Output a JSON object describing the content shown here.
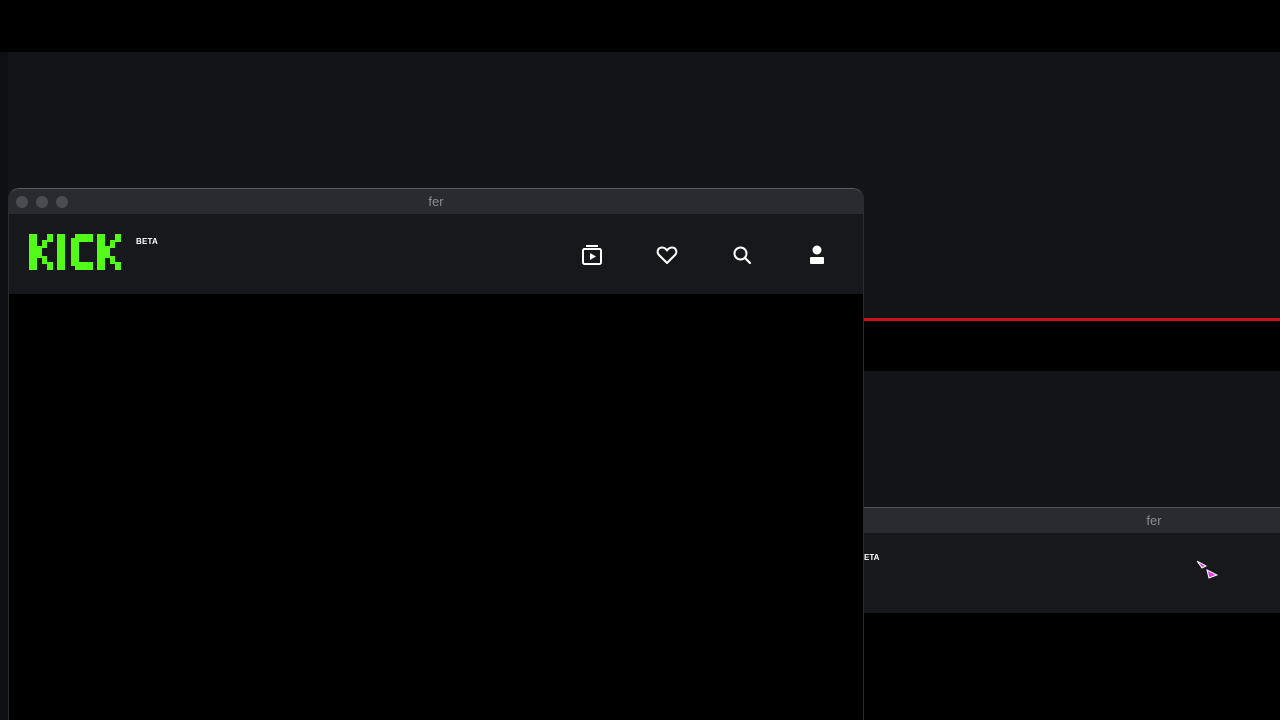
{
  "window": {
    "title": "fer",
    "controls": [
      "close",
      "minimize",
      "maximize"
    ]
  },
  "app": {
    "logo_text": "KICK",
    "beta_label": "BETA",
    "brand_color": "#53fc18",
    "nav": [
      {
        "name": "browse",
        "icon": "browse-icon"
      },
      {
        "name": "following",
        "icon": "heart-icon"
      },
      {
        "name": "search",
        "icon": "search-icon"
      },
      {
        "name": "profile",
        "icon": "user-icon"
      }
    ]
  },
  "background_window": {
    "title": "fer",
    "beta_fragment": "ETA",
    "accent_line_color": "#c8121c"
  },
  "cursor": {
    "icon": "pointer-cursor-icon",
    "color": "#e23ce6"
  }
}
